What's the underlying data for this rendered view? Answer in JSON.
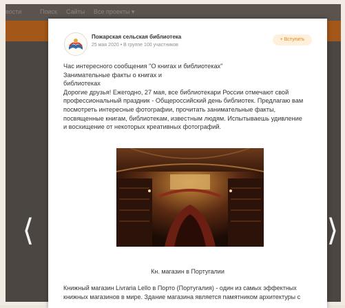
{
  "nav": {
    "items": [
      "вости",
      "Поиск",
      "Сайты",
      "Все проекты ▾"
    ]
  },
  "post": {
    "group_name": "Пожарская сельская библиотека",
    "meta": "25 мая 2020 • В группе 100 участников",
    "join_label": "+ Вступить",
    "lines": [
      "Час интересного сообщения \"О книгах и библиотеках\"",
      "Занимательные факты о книгах и",
      "библиотеках",
      "Дорогие друзья! Ежегодно, 27 мая, все библиотекари России отмечают свой",
      "профессиональный праздник - Общероссийский день библиотек. Предлагаю вам",
      "посмотреть интересные фотографии, прочитать занимательные факты,",
      "посвященные книгам, библиотекам, известным людям. Испытываешь удивление",
      "и восхищение от некоторых креативных фотографий."
    ],
    "photo_caption": "Кн. магазин  в  Португалии",
    "description_lines": [
      "Книжный магазин Livraria Lello в Порто (Португалия) - один из самых эффектных",
      "книжных магазинов в мире. Здание магазина является памятником архитектуры с"
    ]
  },
  "icons": {
    "prev": "chevron-left-icon",
    "next": "chevron-right-icon"
  },
  "colors": {
    "accent": "#ee8208",
    "header_bar": "#b35b10"
  }
}
